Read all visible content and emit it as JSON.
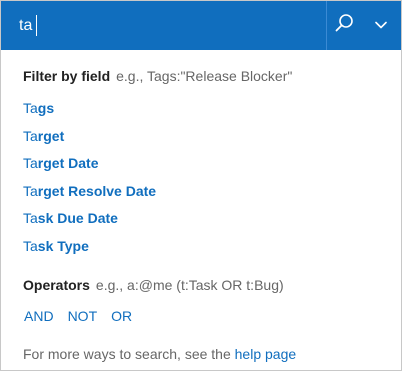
{
  "search": {
    "value": "ta"
  },
  "filter_section": {
    "title": "Filter by field",
    "hint": "e.g., Tags:\"Release Blocker\""
  },
  "fields": [
    {
      "match": "Ta",
      "rest": "gs"
    },
    {
      "match": "Ta",
      "rest": "rget"
    },
    {
      "match": "Ta",
      "rest": "rget Date"
    },
    {
      "match": "Ta",
      "rest": "rget Resolve Date"
    },
    {
      "match": "Ta",
      "rest": "sk Due Date"
    },
    {
      "match": "Ta",
      "rest": "sk Type"
    }
  ],
  "operators_section": {
    "title": "Operators",
    "hint": "e.g., a:@me (t:Task OR t:Bug)"
  },
  "operators": [
    "AND",
    "NOT",
    "OR"
  ],
  "footer": {
    "text": "For more ways to search, see the ",
    "link": "help page"
  },
  "icons": {
    "search": "search-icon",
    "dropdown": "chevron-down-icon"
  },
  "colors": {
    "accent": "#106ebe",
    "link": "#106ebe"
  }
}
